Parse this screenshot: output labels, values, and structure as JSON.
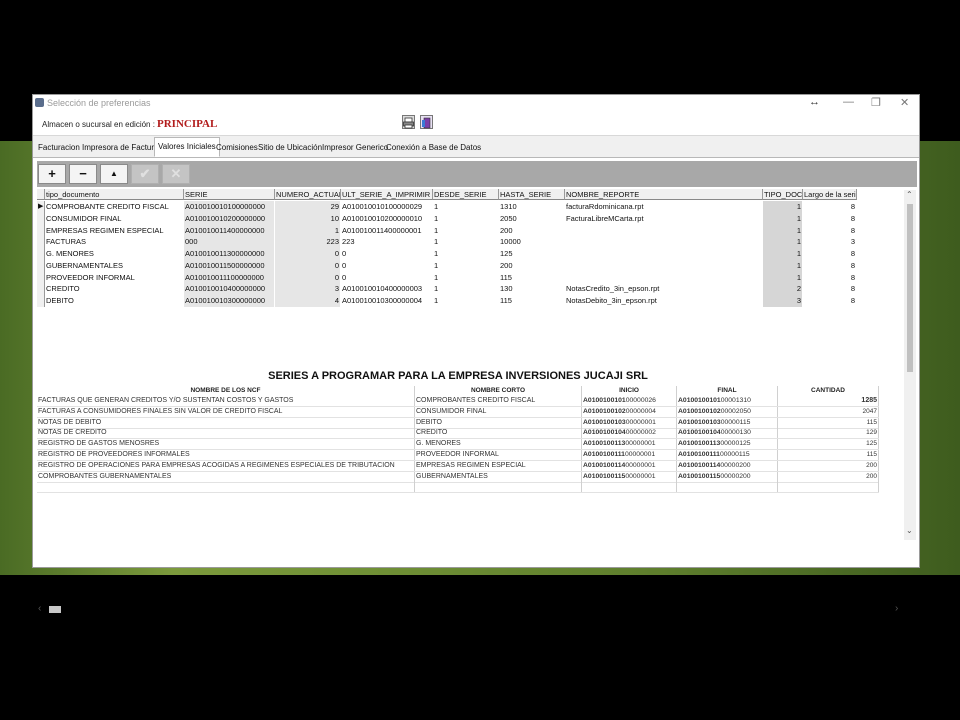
{
  "window": {
    "title": "Selección de preferencias",
    "controls": {
      "move": "↔",
      "minimize": "—",
      "restore": "❐",
      "close": "✕"
    }
  },
  "branch": {
    "label": "Almacen o sucursal en edición :",
    "value": "PRINCIPAL"
  },
  "tabs": [
    {
      "label": "Facturacion"
    },
    {
      "label": "Impresora de Facturas"
    },
    {
      "label": "Valores Iniciales",
      "active": true
    },
    {
      "label": "Comisiones"
    },
    {
      "label": "Sitio de Ubicación"
    },
    {
      "label": "Impresor Generico"
    },
    {
      "label": "Conexión a Base de Datos"
    }
  ],
  "toolbar": {
    "add": "+",
    "remove": "−",
    "up": "▲",
    "confirm": "✔",
    "cancel": "✕"
  },
  "grid": {
    "columns": [
      "tipo_documento",
      "SERIE",
      "NUMERO_ACTUAL",
      "ULT_SERIE_A_IMPRIMIR",
      "DESDE_SERIE",
      "HASTA_SERIE",
      "NOMBRE_REPORTE",
      "TIPO_DOC",
      "Largo de la serie"
    ],
    "rows": [
      {
        "tipo": "COMPROBANTE CREDITO FISCAL",
        "serie": "A010010010100000000",
        "actual": "29",
        "ult": "A010010010100000029",
        "desde": "1",
        "hasta": "1310",
        "reporte": "facturaRdominicana.rpt",
        "tipo_doc": "1",
        "largo": "8"
      },
      {
        "tipo": "CONSUMIDOR FINAL",
        "serie": "A010010010200000000",
        "actual": "10",
        "ult": "A010010010200000010",
        "desde": "1",
        "hasta": "2050",
        "reporte": "FacturaLibreMCarta.rpt",
        "tipo_doc": "1",
        "largo": "8"
      },
      {
        "tipo": "EMPRESAS REGIMEN ESPECIAL",
        "serie": "A010010011400000000",
        "actual": "1",
        "ult": "A010010011400000001",
        "desde": "1",
        "hasta": "200",
        "reporte": "",
        "tipo_doc": "1",
        "largo": "8"
      },
      {
        "tipo": "FACTURAS",
        "serie": "000",
        "actual": "223",
        "ult": "223",
        "desde": "1",
        "hasta": "10000",
        "reporte": "",
        "tipo_doc": "1",
        "largo": "3"
      },
      {
        "tipo": "G. MENORES",
        "serie": "A010010011300000000",
        "actual": "0",
        "ult": "0",
        "desde": "1",
        "hasta": "125",
        "reporte": "",
        "tipo_doc": "1",
        "largo": "8"
      },
      {
        "tipo": "GUBERNAMENTALES",
        "serie": "A010010011500000000",
        "actual": "0",
        "ult": "0",
        "desde": "1",
        "hasta": "200",
        "reporte": "",
        "tipo_doc": "1",
        "largo": "8"
      },
      {
        "tipo": "PROVEEDOR INFORMAL",
        "serie": "A010010011100000000",
        "actual": "0",
        "ult": "0",
        "desde": "1",
        "hasta": "115",
        "reporte": "",
        "tipo_doc": "1",
        "largo": "8"
      },
      {
        "tipo": "CREDITO",
        "serie": "A010010010400000000",
        "actual": "3",
        "ult": "A010010010400000003",
        "desde": "1",
        "hasta": "130",
        "reporte": "NotasCredito_3in_epson.rpt",
        "tipo_doc": "2",
        "largo": "8"
      },
      {
        "tipo": "DEBITO",
        "serie": "A010010010300000000",
        "actual": "4",
        "ult": "A010010010300000004",
        "desde": "1",
        "hasta": "115",
        "reporte": "NotasDebito_3in_epson.rpt",
        "tipo_doc": "3",
        "largo": "8"
      }
    ]
  },
  "sheet": {
    "title": "SERIES A PROGRAMAR PARA LA EMPRESA INVERSIONES JUCAJI SRL",
    "headers": [
      "NOMBRE DE LOS NCF",
      "NOMBRE CORTO",
      "INICIO",
      "FINAL",
      "CANTIDAD"
    ],
    "rows": [
      {
        "nombre": "FACTURAS QUE GENERAN CREDITOS Y/O SUSTENTAN COSTOS Y GASTOS",
        "corto": "COMPROBANTES CREDITO FISCAL",
        "inicio_pre": "A0100100101",
        "inicio_suf": "00000026",
        "final_pre": "A0100100101",
        "final_suf": "00001310",
        "cantidad": "1285"
      },
      {
        "nombre": "FACTURAS A CONSUMIDORES FINALES SIN VALOR DE CREDITO FISCAL",
        "corto": "CONSUMIDOR FINAL",
        "inicio_pre": "A0100100102",
        "inicio_suf": "00000004",
        "final_pre": "A0100100102",
        "final_suf": "00002050",
        "cantidad": "2047"
      },
      {
        "nombre": "NOTAS DE DEBITO",
        "corto": "DEBITO",
        "inicio_pre": "A0100100103",
        "inicio_suf": "00000001",
        "final_pre": "A0100100103",
        "final_suf": "00000115",
        "cantidad": "115"
      },
      {
        "nombre": "NOTAS DE CREDITO",
        "corto": "CREDITO",
        "inicio_pre": "A0100100104",
        "inicio_suf": "00000002",
        "final_pre": "A0100100104",
        "final_suf": "00000130",
        "cantidad": "129"
      },
      {
        "nombre": "REGISTRO DE GASTOS MENOSRES",
        "corto": "G. MENORES",
        "inicio_pre": "A0100100113",
        "inicio_suf": "00000001",
        "final_pre": "A0100100113",
        "final_suf": "00000125",
        "cantidad": "125"
      },
      {
        "nombre": "REGISTRO DE PROVEEDORES INFORMALES",
        "corto": "PROVEEDOR INFORMAL",
        "inicio_pre": "A0100100111",
        "inicio_suf": "00000001",
        "final_pre": "A0100100111",
        "final_suf": "00000115",
        "cantidad": "115"
      },
      {
        "nombre": "REGISTRO DE OPERACIONES PARA EMPRESAS ACOGIDAS A REGIMENES ESPECIALES DE TRIBUTACION",
        "corto": "EMPRESAS REGIMEN ESPECIAL",
        "inicio_pre": "A0100100114",
        "inicio_suf": "00000001",
        "final_pre": "A0100100114",
        "final_suf": "00000200",
        "cantidad": "200"
      },
      {
        "nombre": "COMPROBANTES GUBERNAMENTALES",
        "corto": "GUBERNAMENTALES",
        "inicio_pre": "A0100100115",
        "inicio_suf": "00000001",
        "final_pre": "A0100100115",
        "final_suf": "00000200",
        "cantidad": "200"
      }
    ]
  },
  "icons": {
    "app": "app-window-icon",
    "printer": "printer-icon",
    "door": "exit-door-icon",
    "row_pointer": "▶",
    "scroll_up": "⌃",
    "scroll_down": "⌄",
    "scroll_left": "‹",
    "scroll_right": "›"
  },
  "colors": {
    "branch_value": "#b21c1c",
    "toolbar": "#a8a8a8",
    "grid_cell": "#e6e6e6"
  }
}
